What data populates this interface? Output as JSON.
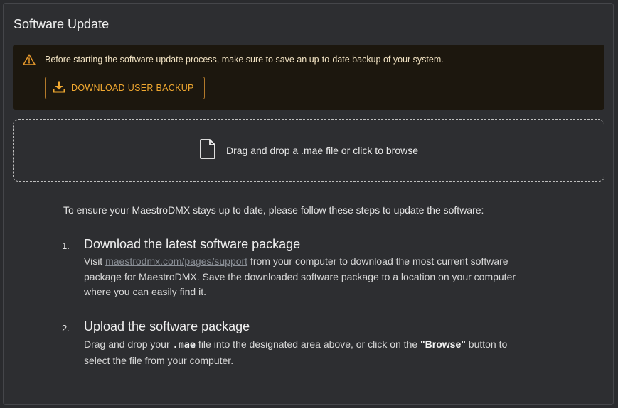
{
  "panel": {
    "title": "Software Update"
  },
  "alert": {
    "icon": "warning-triangle-icon",
    "message": "Before starting the software update process, make sure to save an up-to-date backup of your system.",
    "button_icon": "download-icon",
    "button_label": "DOWNLOAD USER BACKUP",
    "accent_color": "#f0a830"
  },
  "dropzone": {
    "icon": "file-icon",
    "label": "Drag and drop a .mae file or click to browse"
  },
  "instructions": {
    "intro": "To ensure your MaestroDMX stays up to date, please follow these steps to update the software:",
    "steps": [
      {
        "number": "1.",
        "title": "Download the latest software package",
        "body_prefix": "Visit ",
        "link_text": "maestrodmx.com/pages/support",
        "body_suffix_line1": " from your computer to download the most current software",
        "body_line2": "package for MaestroDMX. Save the downloaded software package to a location on your computer",
        "body_line3": "where you can easily find it."
      },
      {
        "number": "2.",
        "title": "Upload the software package",
        "body_prefix": "Drag and drop your ",
        "code": ".mae",
        "body_mid": " file into the designated area above, or click on the ",
        "bold": "\"Browse\"",
        "body_suffix": " button to",
        "body_line2": "select the file from your computer."
      }
    ]
  }
}
